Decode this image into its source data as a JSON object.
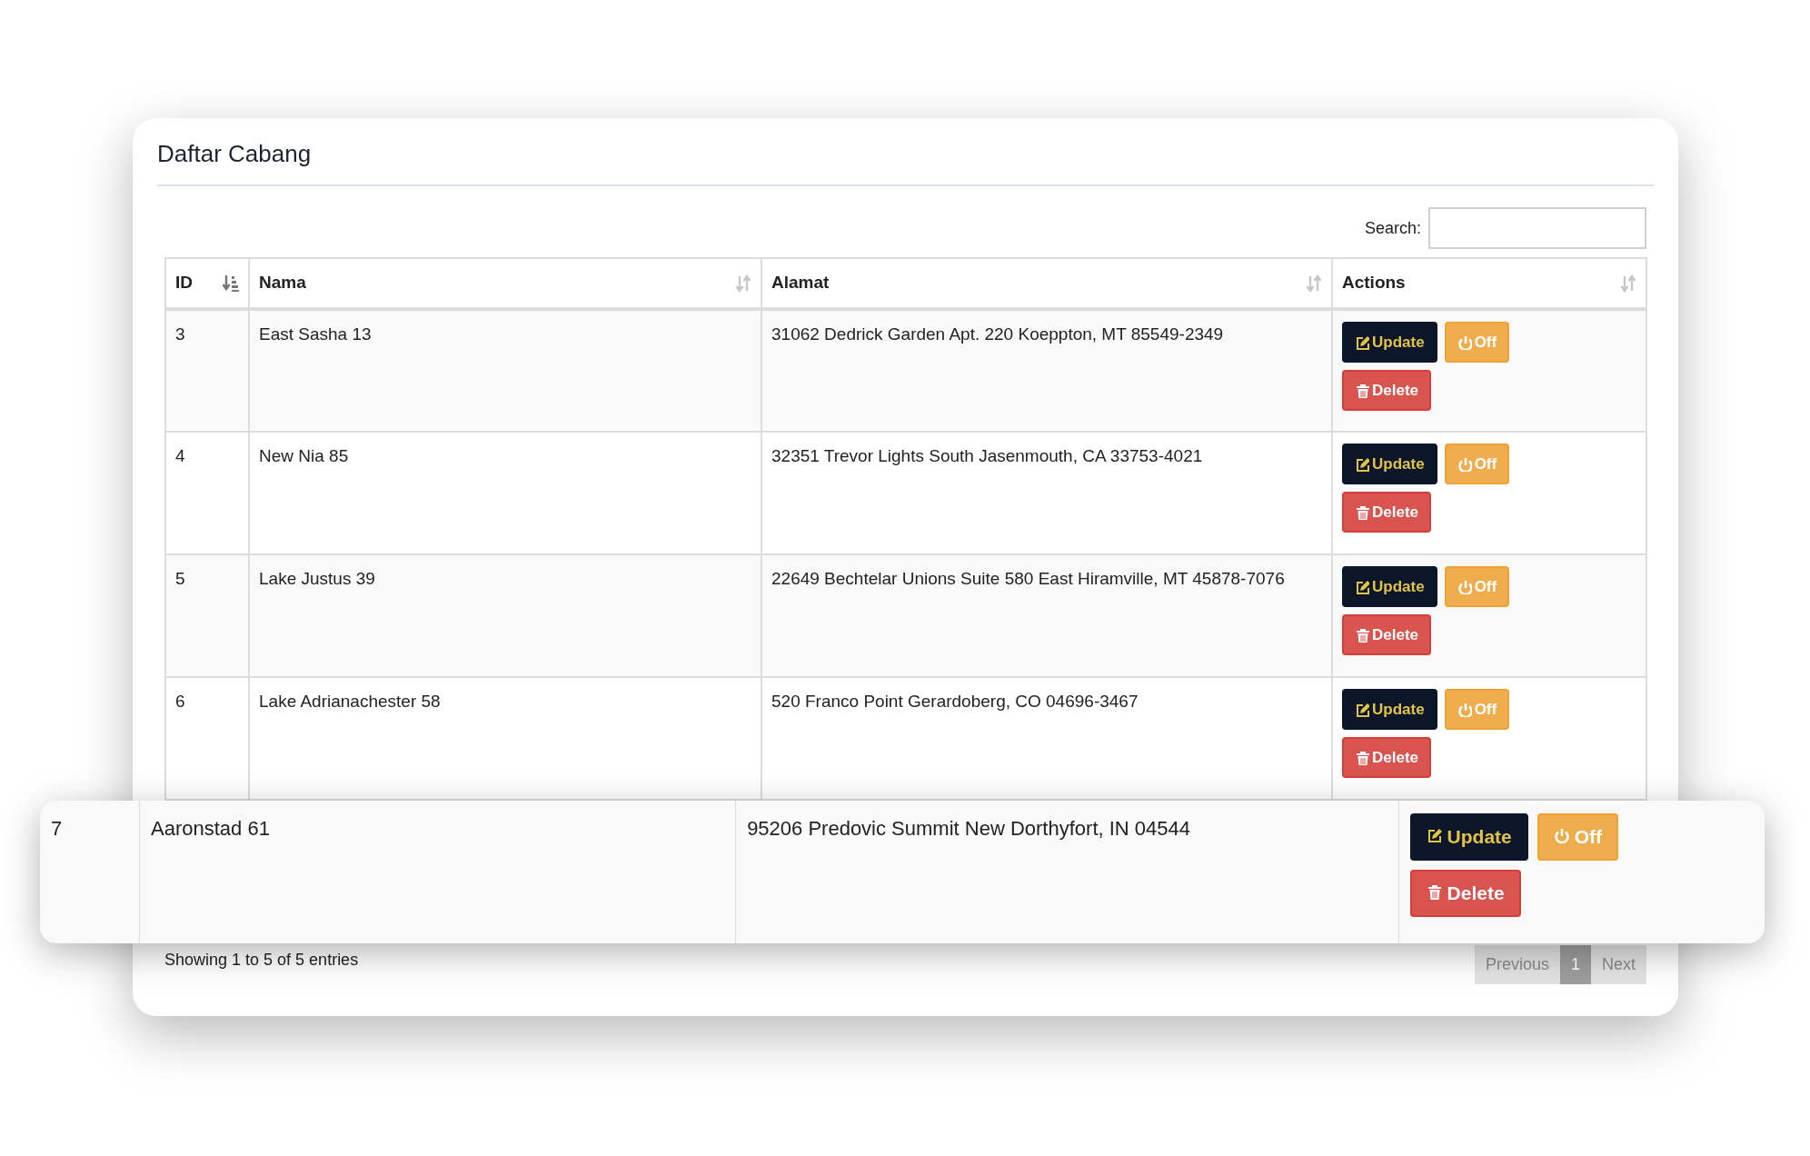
{
  "title": "Daftar Cabang",
  "search": {
    "label": "Search:"
  },
  "table": {
    "columns": [
      {
        "label": "ID",
        "sorted": true
      },
      {
        "label": "Nama",
        "sorted": false
      },
      {
        "label": "Alamat",
        "sorted": false
      },
      {
        "label": "Actions",
        "sorted": false
      }
    ],
    "rows": [
      {
        "id": "3",
        "nama": "East Sasha 13",
        "alamat": "31062 Dedrick Garden Apt. 220 Koeppton, MT 85549-2349",
        "highlighted": false,
        "actions": [
          {
            "kind": "update",
            "label": "Update"
          },
          {
            "kind": "off",
            "label": "Off"
          },
          {
            "kind": "delete",
            "label": "Delete"
          }
        ]
      },
      {
        "id": "4",
        "nama": "New Nia 85",
        "alamat": "32351 Trevor Lights South Jasenmouth, CA 33753-4021",
        "highlighted": false,
        "actions": [
          {
            "kind": "update",
            "label": "Update"
          },
          {
            "kind": "off",
            "label": "Off"
          },
          {
            "kind": "delete",
            "label": "Delete"
          }
        ]
      },
      {
        "id": "5",
        "nama": "Lake Justus 39",
        "alamat": "22649 Bechtelar Unions Suite 580 East Hiramville, MT 45878-7076",
        "highlighted": false,
        "actions": [
          {
            "kind": "update",
            "label": "Update"
          },
          {
            "kind": "off",
            "label": "Off"
          },
          {
            "kind": "delete",
            "label": "Delete"
          }
        ]
      },
      {
        "id": "6",
        "nama": "Lake Adrianachester 58",
        "alamat": "520 Franco Point Gerardoberg, CO 04696-3467",
        "highlighted": false,
        "actions": [
          {
            "kind": "update",
            "label": "Update"
          },
          {
            "kind": "off",
            "label": "Off"
          },
          {
            "kind": "delete",
            "label": "Delete"
          }
        ]
      },
      {
        "id": "7",
        "nama": "Aaronstad 61",
        "alamat": "95206 Predovic Summit New Dorthyfort, IN 04544",
        "highlighted": true,
        "actions": [
          {
            "kind": "update",
            "label": "Update"
          },
          {
            "kind": "off",
            "label": "Off"
          },
          {
            "kind": "delete",
            "label": "Delete"
          }
        ]
      }
    ]
  },
  "footer": {
    "info": "Showing 1 to 5 of 5 entries",
    "pagination": [
      {
        "label": "Previous",
        "selected": false
      },
      {
        "label": "1",
        "selected": true
      },
      {
        "label": "Next",
        "selected": false
      }
    ]
  }
}
